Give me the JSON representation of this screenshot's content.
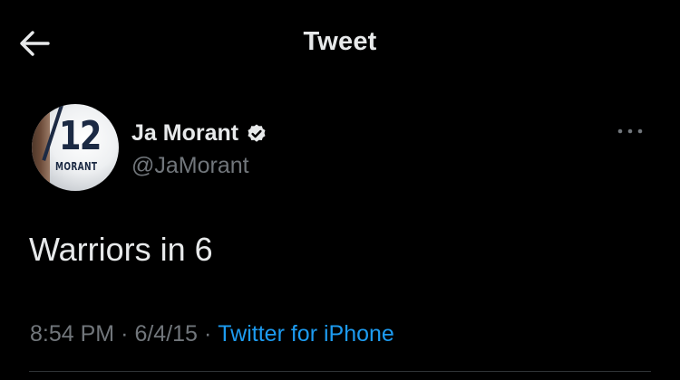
{
  "header": {
    "title": "Tweet",
    "back_icon": "arrow-left-icon"
  },
  "tweet": {
    "author": {
      "display_name": "Ja Morant",
      "handle": "@JaMorant",
      "verified": true,
      "verified_icon": "verified-badge-icon",
      "avatar": {
        "jersey_number": "12",
        "jersey_name": "MORANT"
      }
    },
    "more_icon": "more-options-icon",
    "text": "Warriors in 6",
    "meta": {
      "time": "8:54 PM",
      "separator": "·",
      "date": "6/4/15",
      "source": "Twitter for iPhone"
    }
  },
  "colors": {
    "background": "#000000",
    "primary_text": "#e7e9ea",
    "secondary_text": "#71767b",
    "link": "#1d9bf0",
    "divider": "#2f3336"
  }
}
